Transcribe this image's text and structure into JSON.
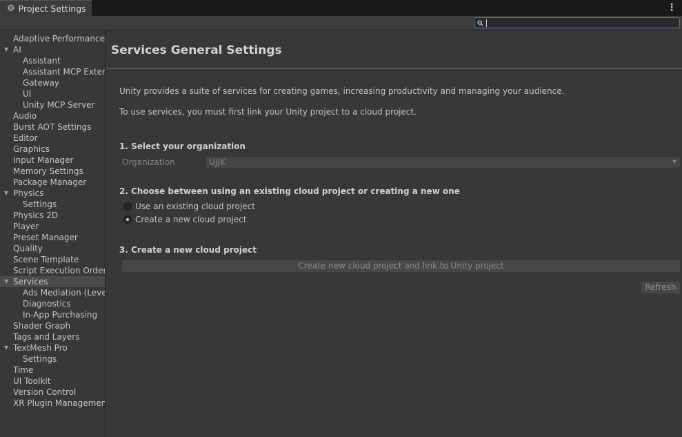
{
  "window": {
    "tab_title": "Project Settings",
    "tab_icon": "gear-icon",
    "menu_icon": "kebab-menu-icon"
  },
  "search": {
    "value": "",
    "icon": "search-icon"
  },
  "sidebar": {
    "items": [
      {
        "label": "Adaptive Performance",
        "level": 0
      },
      {
        "label": "AI",
        "level": 0,
        "expanded": true
      },
      {
        "label": "Assistant",
        "level": 1
      },
      {
        "label": "Assistant MCP Extensions",
        "level": 1
      },
      {
        "label": "Gateway",
        "level": 1
      },
      {
        "label": "UI",
        "level": 1
      },
      {
        "label": "Unity MCP Server",
        "level": 1
      },
      {
        "label": "Audio",
        "level": 0
      },
      {
        "label": "Burst AOT Settings",
        "level": 0
      },
      {
        "label": "Editor",
        "level": 0
      },
      {
        "label": "Graphics",
        "level": 0
      },
      {
        "label": "Input Manager",
        "level": 0
      },
      {
        "label": "Memory Settings",
        "level": 0
      },
      {
        "label": "Package Manager",
        "level": 0
      },
      {
        "label": "Physics",
        "level": 0,
        "expanded": true
      },
      {
        "label": "Settings",
        "level": 1
      },
      {
        "label": "Physics 2D",
        "level": 0
      },
      {
        "label": "Player",
        "level": 0
      },
      {
        "label": "Preset Manager",
        "level": 0
      },
      {
        "label": "Quality",
        "level": 0
      },
      {
        "label": "Scene Template",
        "level": 0
      },
      {
        "label": "Script Execution Order",
        "level": 0
      },
      {
        "label": "Services",
        "level": 0,
        "expanded": true,
        "selected": true
      },
      {
        "label": "Ads Mediation (LevelPlay)",
        "level": 1
      },
      {
        "label": "Diagnostics",
        "level": 1
      },
      {
        "label": "In-App Purchasing",
        "level": 1
      },
      {
        "label": "Shader Graph",
        "level": 0
      },
      {
        "label": "Tags and Layers",
        "level": 0
      },
      {
        "label": "TextMesh Pro",
        "level": 0,
        "expanded": true
      },
      {
        "label": "Settings",
        "level": 1
      },
      {
        "label": "Time",
        "level": 0
      },
      {
        "label": "UI Toolkit",
        "level": 0
      },
      {
        "label": "Version Control",
        "level": 0
      },
      {
        "label": "XR Plugin Management",
        "level": 0
      }
    ]
  },
  "main": {
    "title": "Services General Settings",
    "intro_1": "Unity provides a suite of services for creating games, increasing productivity and managing your audience.",
    "intro_2": "To use services, you must first link your Unity project to a cloud project.",
    "step1_title": "1. Select your organization",
    "org_label": "Organization",
    "org_value": "UJJK",
    "step2_title": "2. Choose between using an existing cloud project or creating a new one",
    "radio_existing": "Use an existing cloud project",
    "radio_new": "Create a new cloud project",
    "selected_option": "Create a new cloud project",
    "step3_title": "3. Create a new cloud project",
    "create_button": "Create new cloud project and link to Unity project",
    "refresh_button": "Refresh"
  },
  "colors": {
    "background": "#383838",
    "tabbar": "#191919",
    "selected_item": "#4b4b4b",
    "search_focus": "#3a79bb"
  }
}
